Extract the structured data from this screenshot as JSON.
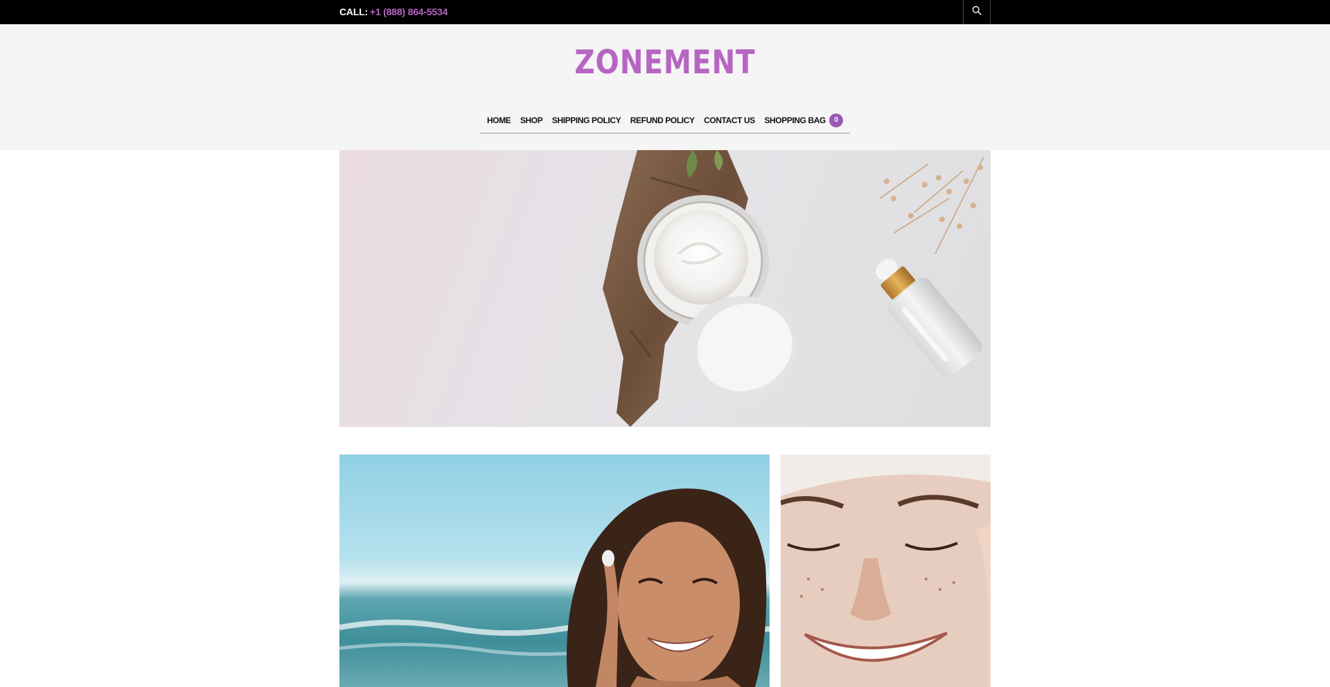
{
  "topbar": {
    "call_label": "CALL:",
    "phone": "+1 (888) 864-5534",
    "search_icon": "search-icon"
  },
  "header": {
    "brand": "ZONEMENT"
  },
  "nav": {
    "items": [
      {
        "label": "HOME"
      },
      {
        "label": "SHOP"
      },
      {
        "label": "SHIPPING POLICY"
      },
      {
        "label": "REFUND POLICY"
      },
      {
        "label": "CONTACT US"
      }
    ],
    "bag_label": "SHOPPING BAG",
    "bag_count": "0"
  },
  "colors": {
    "brand": "#b765c2",
    "badge": "#9b59b6",
    "topbar": "#000000",
    "header_bg": "#f5f5f5"
  }
}
